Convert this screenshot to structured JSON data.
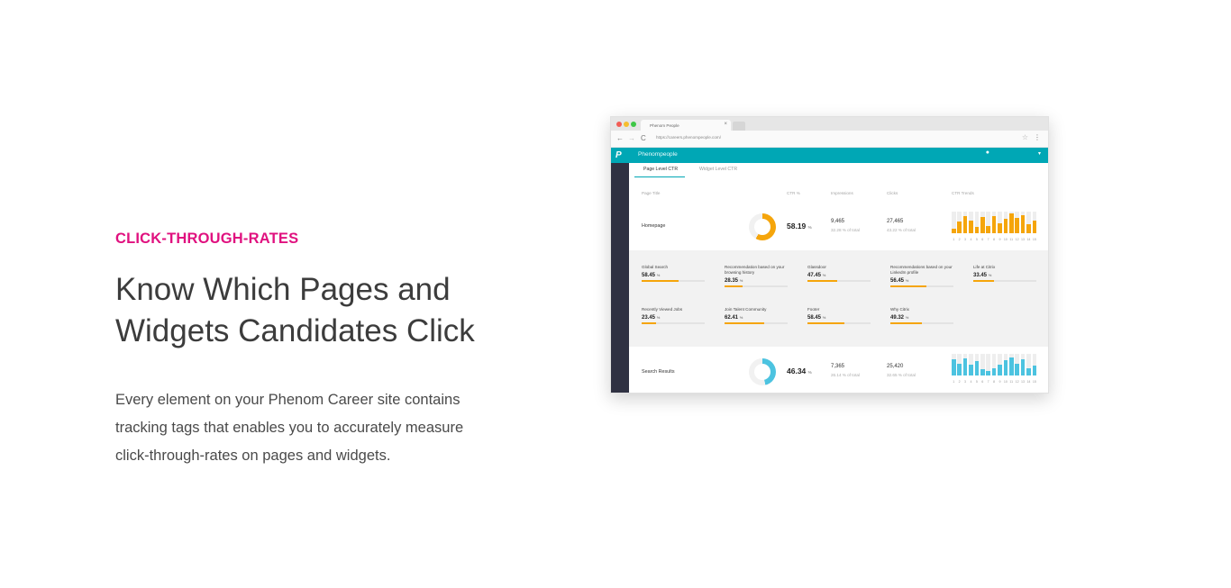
{
  "section": {
    "eyebrow": "CLICK-THROUGH-RATES",
    "headline_line1": "Know Which Pages and",
    "headline_line2": "Widgets Candidates Click",
    "body_line1": "Every element on your Phenom Career site contains",
    "body_line2": "tracking tags that enables you to accurately measure",
    "body_line3": "click-through-rates on pages and widgets."
  },
  "browser": {
    "tab_title": "Phenom People",
    "tab_close": "×",
    "url": "https://careers.phenompeople.com/",
    "nav_back": "←",
    "nav_forward": "→",
    "nav_reload": "C",
    "star": "☆",
    "menu": "⋮"
  },
  "app": {
    "logo": "P",
    "name": "Phenompeople",
    "bell": "🔔",
    "caret": "▾",
    "tabs": [
      {
        "label": "Page Level CTR",
        "active": true
      },
      {
        "label": "Widget Level CTR",
        "active": false
      }
    ],
    "columns": [
      "Page Title",
      "CTR %",
      "Impressions",
      "Clicks",
      "CTR Trends"
    ],
    "colors": {
      "accent": "#00a7b5",
      "orange": "#f5a50b",
      "blue": "#4cc3e0",
      "sidebar": "#2f3142"
    },
    "pct_unit": "%",
    "trend_labels": [
      "1",
      "2",
      "3",
      "4",
      "5",
      "6",
      "7",
      "8",
      "9",
      "10",
      "11",
      "12",
      "13",
      "14",
      "15"
    ],
    "pages": [
      {
        "title": "Homepage",
        "ctr": "58.19",
        "ctr_fraction": 0.5819,
        "impressions": "9,465",
        "impressions_sub": "32.28 % of total",
        "clicks": "27,465",
        "clicks_sub": "43.22 % of total",
        "color": "#f5a50b",
        "trend": [
          0.2,
          0.55,
          0.8,
          0.6,
          0.3,
          0.75,
          0.35,
          0.8,
          0.45,
          0.65,
          0.9,
          0.7,
          0.85,
          0.4,
          0.6
        ]
      },
      {
        "title": "Search Results",
        "ctr": "46.34",
        "ctr_fraction": 0.4634,
        "impressions": "7,365",
        "impressions_sub": "26.14 % of total",
        "clicks": "25,420",
        "clicks_sub": "32.65 % of total",
        "color": "#4cc3e0",
        "trend": [
          0.75,
          0.55,
          0.8,
          0.5,
          0.65,
          0.3,
          0.2,
          0.35,
          0.5,
          0.7,
          0.85,
          0.55,
          0.75,
          0.35,
          0.45
        ]
      }
    ],
    "widgets": [
      {
        "name": "Global Search",
        "value": "58.45",
        "fraction": 0.5845
      },
      {
        "name": "Recommendation based on your browsing history",
        "value": "28.35",
        "fraction": 0.2835
      },
      {
        "name": "Glassdoor",
        "value": "47.45",
        "fraction": 0.4745
      },
      {
        "name": "Recommendations based on your LinkedIn profile",
        "value": "56.45",
        "fraction": 0.5645
      },
      {
        "name": "Life at Citrix",
        "value": "33.45",
        "fraction": 0.3345
      },
      {
        "name": "Recently Viewed Jobs",
        "value": "23.45",
        "fraction": 0.2345
      },
      {
        "name": "Join Talent Community",
        "value": "62.41",
        "fraction": 0.6241
      },
      {
        "name": "Footer",
        "value": "58.45",
        "fraction": 0.5845
      },
      {
        "name": "Why Citrix",
        "value": "49.32",
        "fraction": 0.4932
      }
    ]
  }
}
